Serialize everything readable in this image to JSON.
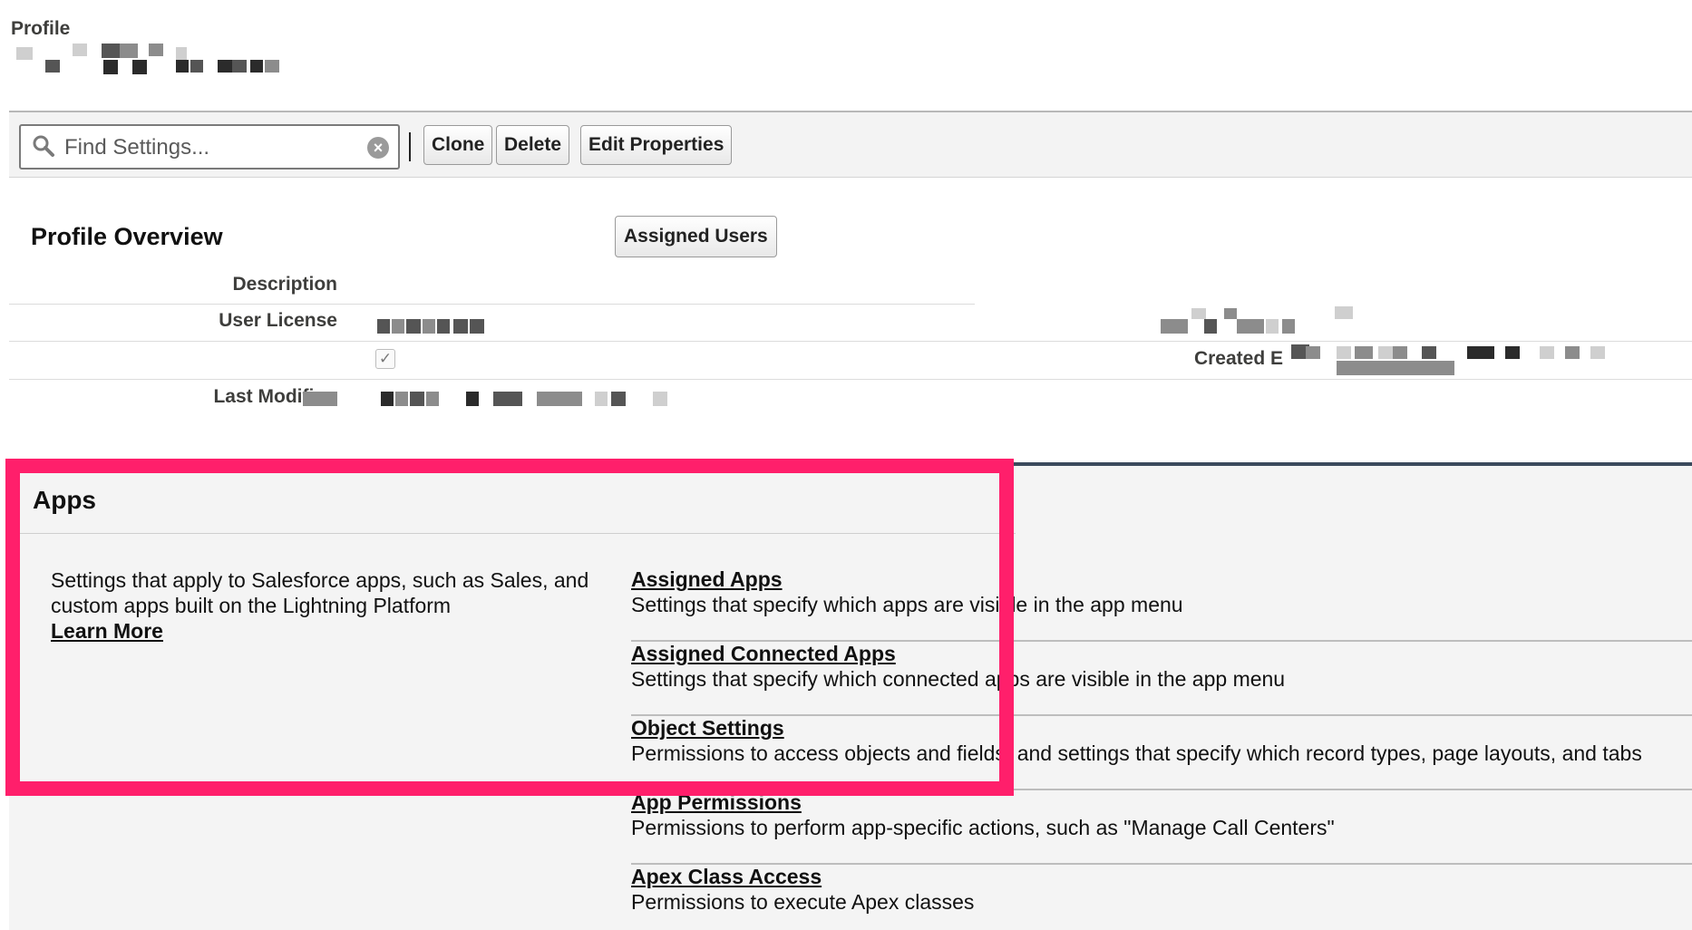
{
  "header": {
    "page_label": "Profile"
  },
  "toolbar": {
    "search_placeholder": "Find Settings...",
    "clone_label": "Clone",
    "delete_label": "Delete",
    "edit_properties_label": "Edit Properties"
  },
  "overview": {
    "title": "Profile Overview",
    "assigned_users_label": "Assigned Users",
    "fields": {
      "description": "Description",
      "user_license": "User License",
      "last_modified": "Last Modifie",
      "created_by": "Created E"
    }
  },
  "apps": {
    "title": "Apps",
    "description": "Settings that apply to Salesforce apps, such as Sales, and custom apps built on the Lightning Platform",
    "learn_more": "Learn More",
    "items": [
      {
        "title": "Assigned Apps",
        "desc": "Settings that specify which apps are visible in the app menu"
      },
      {
        "title": "Assigned Connected Apps",
        "desc": "Settings that specify which connected apps are visible in the app menu"
      },
      {
        "title": "Object Settings",
        "desc": "Permissions to access objects and fields, and settings that specify which record types, page layouts, and tabs"
      },
      {
        "title": "App Permissions",
        "desc": "Permissions to perform app-specific actions, such as \"Manage Call Centers\""
      },
      {
        "title": "Apex Class Access",
        "desc": "Permissions to execute Apex classes"
      }
    ]
  },
  "colors": {
    "highlight": "#ff1f6b",
    "panel_border": "#3b4a5c"
  },
  "icons": {
    "search": "search-icon",
    "clear": "clear-icon",
    "checkbox": "checkmark-icon"
  }
}
